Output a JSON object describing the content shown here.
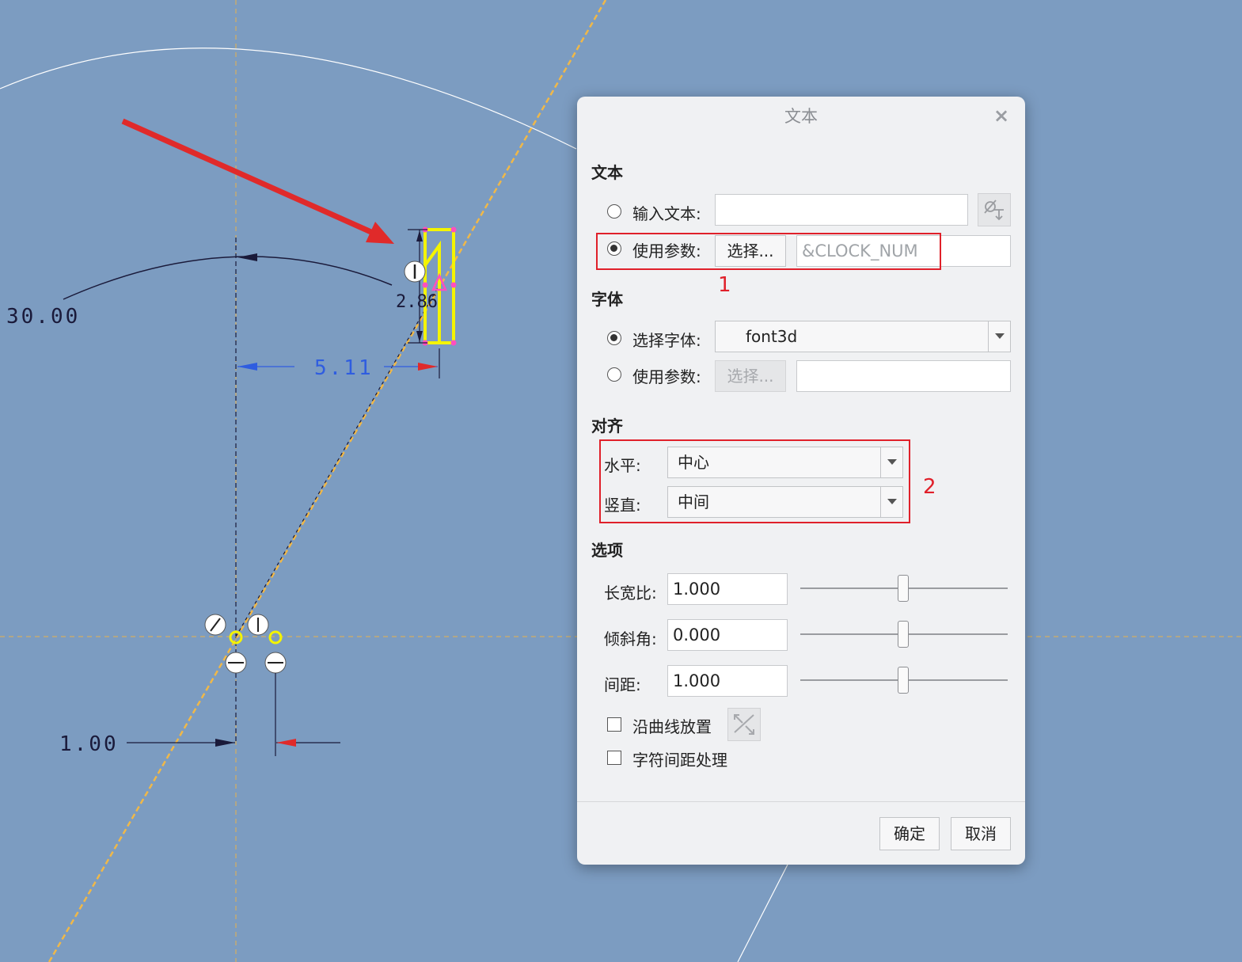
{
  "sketch": {
    "dimensions": {
      "angle": "30.00",
      "text_height": "2.86",
      "horizontal_offset": "5.11",
      "bottom_offset": "1.00"
    },
    "glyph": "1"
  },
  "dialog": {
    "title": "文本",
    "close_label": "×",
    "text_section": {
      "heading": "文本",
      "input_text_label": "输入文本:",
      "input_text_value": "",
      "use_param_label": "使用参数:",
      "select_button": "选择...",
      "param_value": "&CLOCK_NUM",
      "selected": "use_param"
    },
    "font_section": {
      "heading": "字体",
      "select_font_label": "选择字体:",
      "font_value": "font3d",
      "use_param_label": "使用参数:",
      "select_button": "选择...",
      "param_value": "",
      "selected": "select_font"
    },
    "align_section": {
      "heading": "对齐",
      "horizontal_label": "水平:",
      "horizontal_value": "中心",
      "vertical_label": "竖直:",
      "vertical_value": "中间"
    },
    "options_section": {
      "heading": "选项",
      "aspect_label": "长宽比:",
      "aspect_value": "1.000",
      "slant_label": "倾斜角:",
      "slant_value": "0.000",
      "spacing_label": "间距:",
      "spacing_value": "1.000",
      "along_curve_label": "沿曲线放置",
      "along_curve_checked": false,
      "kerning_label": "字符间距处理",
      "kerning_checked": false
    },
    "ok_button": "确定",
    "cancel_button": "取消"
  },
  "annotations": {
    "marker_1": "1",
    "marker_2": "2"
  },
  "colors": {
    "background": "#7c9cc1",
    "highlight_red": "#e0202a",
    "glyph_yellow": "#f4f400",
    "centerline_orange": "#e8b24a"
  }
}
